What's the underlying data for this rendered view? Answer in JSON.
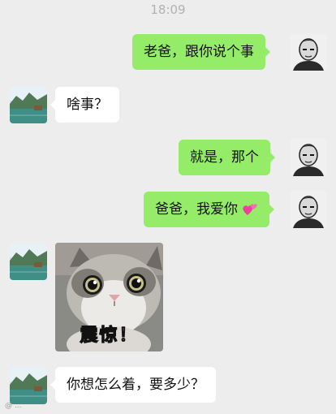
{
  "status": {
    "time": "18:09"
  },
  "messages": [
    {
      "sender": "me",
      "text": "老爸，跟你说个事"
    },
    {
      "sender": "dad",
      "text": "啥事？"
    },
    {
      "sender": "me",
      "text": "就是，那个"
    },
    {
      "sender": "me",
      "text": "爸爸，我爱你",
      "emoji": "pink-hearts-icon"
    },
    {
      "sender": "dad",
      "type": "sticker",
      "caption": "震惊！",
      "sticker_icon": "shocked-cat-icon"
    },
    {
      "sender": "dad",
      "text": "你想怎么着，要多少？"
    }
  ],
  "avatars": {
    "me": "man-portrait-avatar",
    "dad": "lake-landscape-avatar"
  },
  "watermark": "@ ...",
  "colors": {
    "background": "#ededed",
    "my_bubble": "#95ec69",
    "their_bubble": "#ffffff",
    "timestamp": "#b2b2b2"
  }
}
